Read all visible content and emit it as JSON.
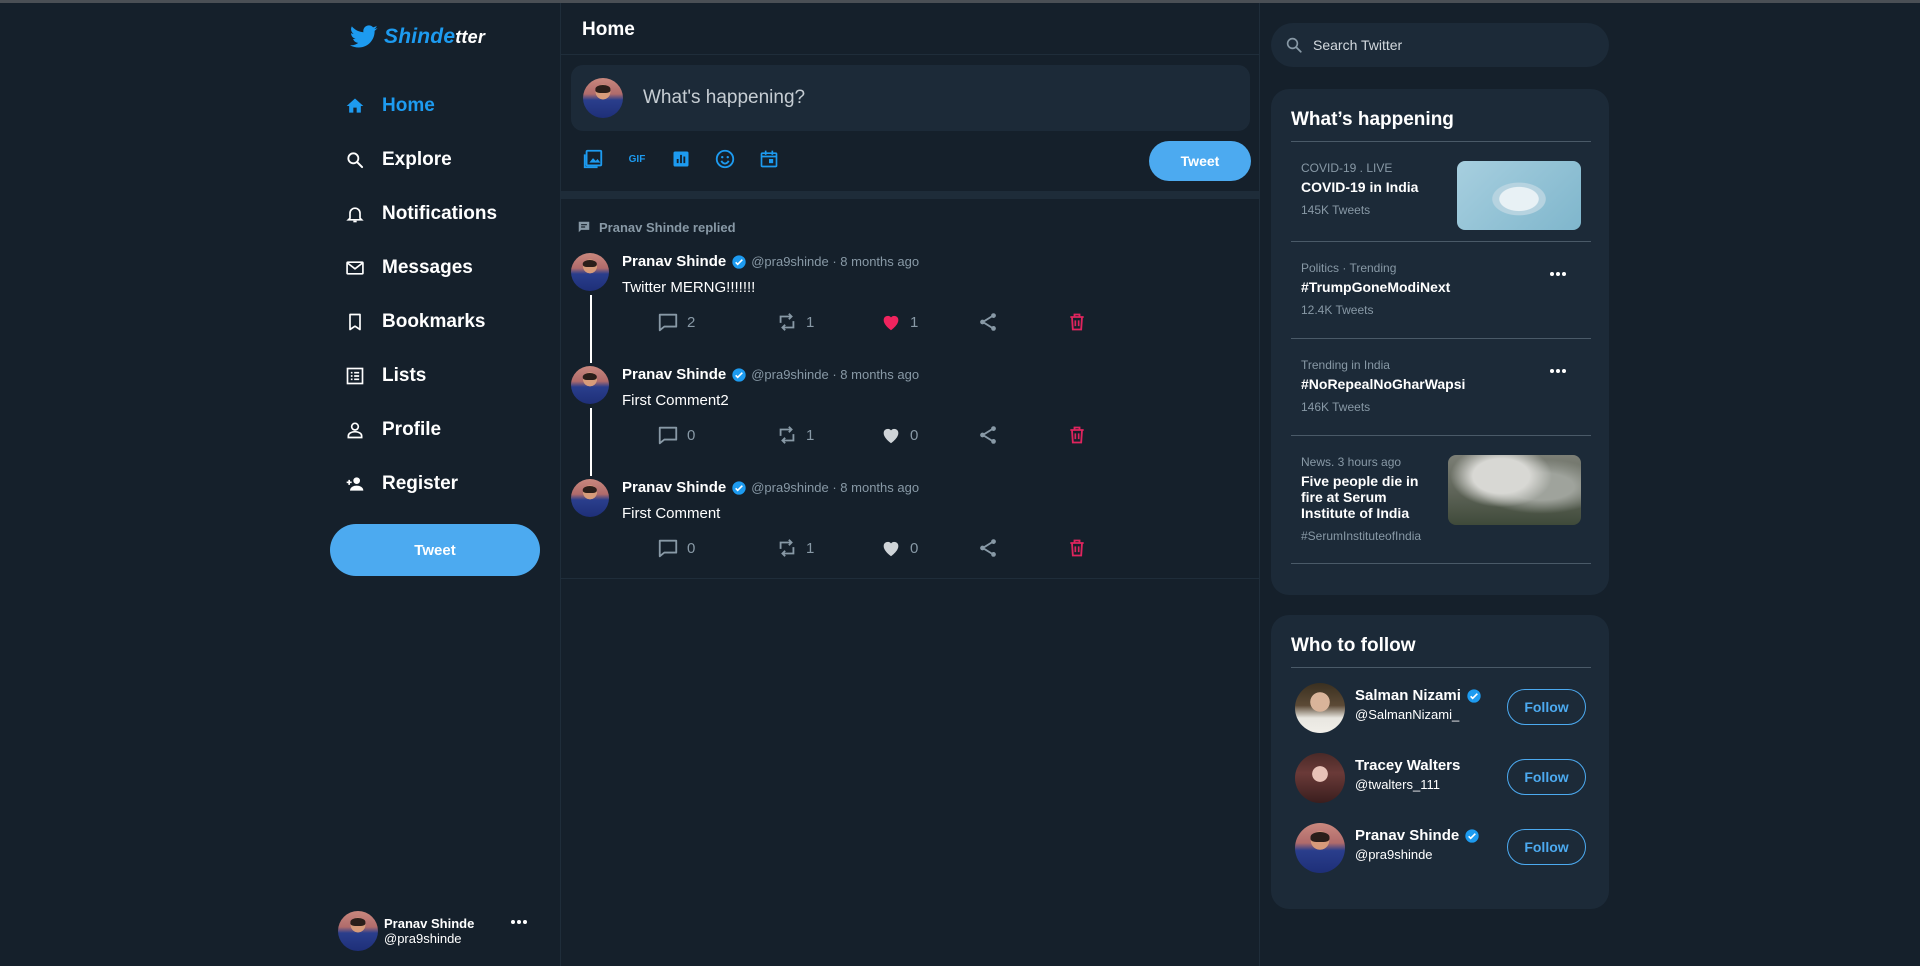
{
  "app": {
    "logo_part1": "Shinde",
    "logo_part2": "tter"
  },
  "sidebar": {
    "items": [
      {
        "label": "Home",
        "icon": "home-icon",
        "active": true
      },
      {
        "label": "Explore",
        "icon": "search-icon"
      },
      {
        "label": "Notifications",
        "icon": "bell-icon"
      },
      {
        "label": "Messages",
        "icon": "mail-icon"
      },
      {
        "label": "Bookmarks",
        "icon": "bookmark-icon"
      },
      {
        "label": "Lists",
        "icon": "list-icon"
      },
      {
        "label": "Profile",
        "icon": "person-icon"
      },
      {
        "label": "Register",
        "icon": "person-add-icon"
      }
    ],
    "tweet_label": "Tweet",
    "account": {
      "name": "Pranav Shinde",
      "handle": "@pra9shinde"
    }
  },
  "main": {
    "title": "Home",
    "compose_placeholder": "What's happening?",
    "tweet_label": "Tweet",
    "tools": [
      "image-icon",
      "gif-icon",
      "poll-icon",
      "emoji-icon",
      "schedule-icon"
    ],
    "gif_label": "GIF",
    "replied_text": "Pranav Shinde replied",
    "tweets": [
      {
        "name": "Pranav Shinde",
        "handle": "@pra9shinde",
        "time": "8 months ago",
        "text": "Twitter MERNG!!!!!!!",
        "replies": "2",
        "retweets": "1",
        "likes": "1",
        "liked": true
      },
      {
        "name": "Pranav Shinde",
        "handle": "@pra9shinde",
        "time": "8 months ago",
        "text": "First Comment2",
        "replies": "0",
        "retweets": "1",
        "likes": "0",
        "liked": false
      },
      {
        "name": "Pranav Shinde",
        "handle": "@pra9shinde",
        "time": "8 months ago",
        "text": "First Comment",
        "replies": "0",
        "retweets": "1",
        "likes": "0",
        "liked": false
      }
    ]
  },
  "right": {
    "search_placeholder": "Search Twitter",
    "happening": {
      "title": "What’s happening",
      "trends": [
        {
          "category": "COVID-19 . LIVE",
          "title": "COVID-19 in India",
          "count": "145K Tweets"
        },
        {
          "category": "Politics · Trending",
          "title": "#TrumpGoneModiNext",
          "count": "12.4K Tweets"
        },
        {
          "category": "Trending in India",
          "title": "#NoRepealNoGharWapsi",
          "count": "146K Tweets"
        },
        {
          "category": "News. 3 hours ago",
          "title": "Five people die in fire at Serum Institute of India",
          "count": "#SerumInstituteofIndia"
        }
      ]
    },
    "follow": {
      "title": "Who to follow",
      "button_label": "Follow",
      "people": [
        {
          "name": "Salman Nizami",
          "handle": "@SalmanNizami_",
          "verified": true
        },
        {
          "name": "Tracey Walters",
          "handle": "@twalters_111",
          "verified": false
        },
        {
          "name": "Pranav Shinde",
          "handle": "@pra9shinde",
          "verified": true
        }
      ]
    }
  },
  "colors": {
    "background": "#15202b",
    "panel": "#1c2a38",
    "accent": "#1d9bf0",
    "button": "#4caaf0",
    "like": "#f91880",
    "delete": "#e0245e",
    "muted": "#8899a6"
  }
}
